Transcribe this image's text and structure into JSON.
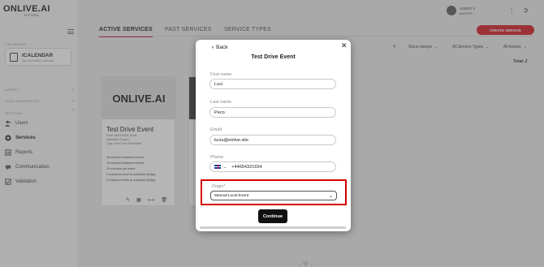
{
  "brand": {
    "logo": "ONLIVE.AI",
    "sub": "EDITORIAL"
  },
  "sidebar": {
    "section_calendars": "CALENDARS",
    "calendar_card": {
      "title": "ICALENDAR",
      "sub": "Synchronization calendar"
    },
    "section_assets": "ASSETS",
    "section_lead_generation": "LEAD GENERATION",
    "section_settings": "SETTINGS",
    "items": [
      {
        "label": "Users",
        "icon": "users-icon"
      },
      {
        "label": "Services",
        "icon": "services-icon"
      },
      {
        "label": "Reports",
        "icon": "reports-icon"
      },
      {
        "label": "Communication",
        "icon": "communication-icon"
      },
      {
        "label": "Validation",
        "icon": "validation-icon"
      }
    ]
  },
  "user": {
    "name": "AGENT 1",
    "role": "●AGENT"
  },
  "tabs": [
    {
      "label": "ACTIVE SERVICES",
      "active": true
    },
    {
      "label": "PAST SERVICES",
      "active": false
    },
    {
      "label": "SERVICE TYPES",
      "active": false
    }
  ],
  "create_button": "CREATE SERVICE",
  "filters": {
    "date": "Since always",
    "types": "All Service Types",
    "assets": "All Assets"
  },
  "total": "Total: 2",
  "service_card": {
    "image_text": "ONLIVE.AI",
    "title": "Test Drive Event",
    "meta": [
      "From 16/07/2025 10:08",
      "Schedule Group 1",
      "Type: Test Drive Scheduled"
    ],
    "lines": [
      "15 minutes between events",
      "15 minutes between events",
      "15 minutes per event",
      "0 maximum time to schedule (Days)",
      "0 maximum time to schedule (Days)"
    ]
  },
  "modal": {
    "back_label": "Back",
    "title": "Test Drive Event",
    "fields": [
      {
        "label": "First name",
        "value": "Luci"
      },
      {
        "label": "Last name",
        "value": "Peco"
      },
      {
        "label": "Email",
        "value": "lucia@onlive.site"
      }
    ],
    "phone": {
      "label": "Phone",
      "value": "+44654321654"
    },
    "origin": {
      "label": "Origin*",
      "selected": "Manual Local Event"
    },
    "continue_label": "Continue"
  },
  "colors": {
    "accent": "#d0121b",
    "highlight_box": "#d40000",
    "dark_button": "#111111"
  }
}
